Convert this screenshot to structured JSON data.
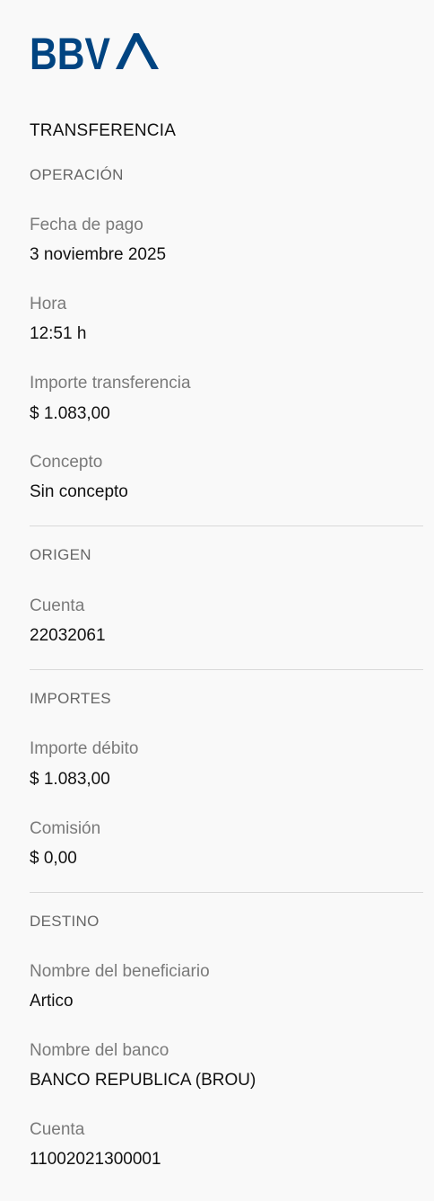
{
  "brand": {
    "logo_text": "BBVA",
    "color": "#004481"
  },
  "page": {
    "title": "TRANSFERENCIA"
  },
  "operacion": {
    "heading": "OPERACIÓN",
    "fecha_label": "Fecha de pago",
    "fecha_value": "3 noviembre 2025",
    "hora_label": "Hora",
    "hora_value": "12:51 h",
    "importe_label": "Importe transferencia",
    "importe_value": "$ 1.083,00",
    "concepto_label": "Concepto",
    "concepto_value": "Sin concepto"
  },
  "origen": {
    "heading": "ORIGEN",
    "cuenta_label": "Cuenta",
    "cuenta_value": "22032061"
  },
  "importes": {
    "heading": "IMPORTES",
    "debito_label": "Importe débito",
    "debito_value": "$ 1.083,00",
    "comision_label": "Comisión",
    "comision_value": "$ 0,00"
  },
  "destino": {
    "heading": "DESTINO",
    "beneficiario_label": "Nombre del beneficiario",
    "beneficiario_value": "Artico",
    "banco_label": "Nombre del banco",
    "banco_value": "BANCO REPUBLICA (BROU)",
    "cuenta_label": "Cuenta",
    "cuenta_value": "11002021300001"
  }
}
